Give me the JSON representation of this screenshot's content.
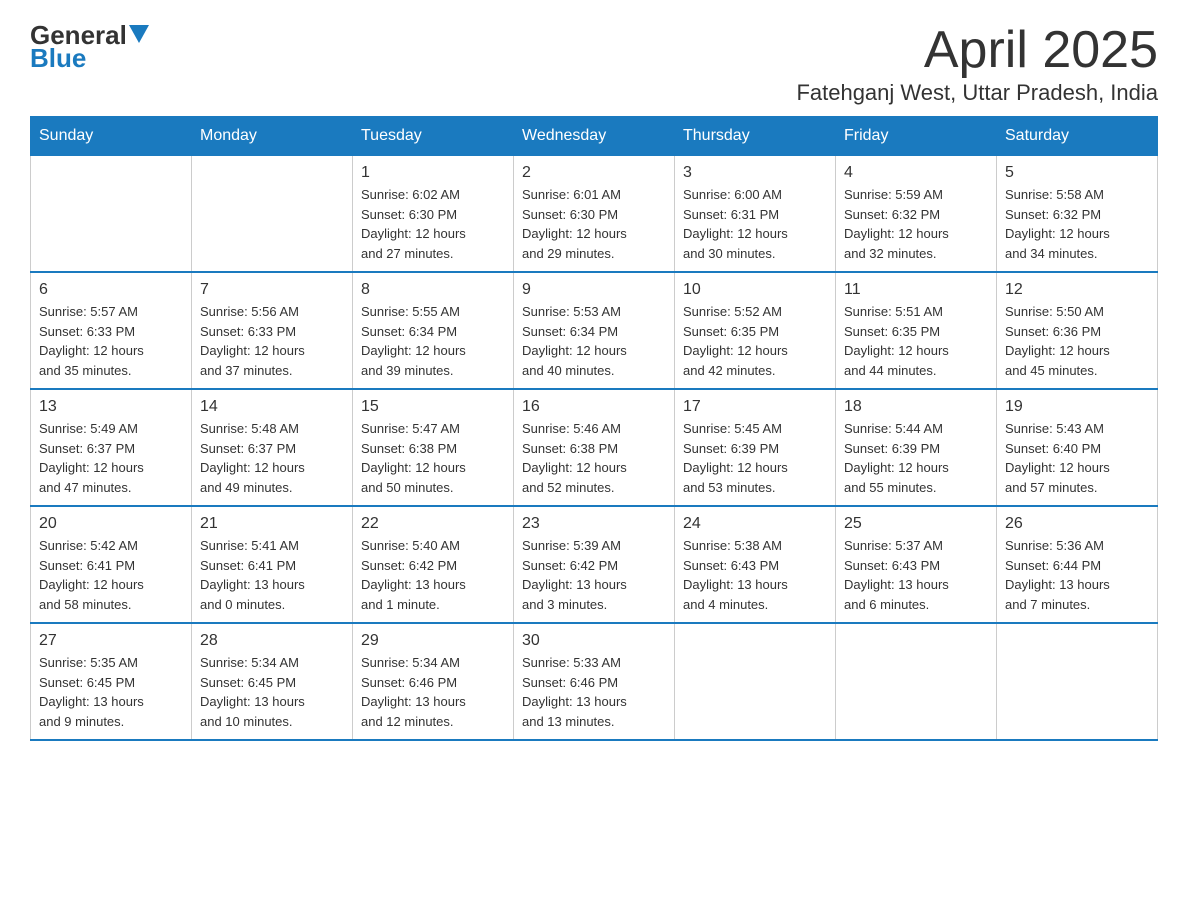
{
  "header": {
    "logo_general": "General",
    "logo_blue": "Blue",
    "month_year": "April 2025",
    "location": "Fatehganj West, Uttar Pradesh, India"
  },
  "weekdays": [
    "Sunday",
    "Monday",
    "Tuesday",
    "Wednesday",
    "Thursday",
    "Friday",
    "Saturday"
  ],
  "weeks": [
    [
      {
        "day": "",
        "info": ""
      },
      {
        "day": "",
        "info": ""
      },
      {
        "day": "1",
        "info": "Sunrise: 6:02 AM\nSunset: 6:30 PM\nDaylight: 12 hours\nand 27 minutes."
      },
      {
        "day": "2",
        "info": "Sunrise: 6:01 AM\nSunset: 6:30 PM\nDaylight: 12 hours\nand 29 minutes."
      },
      {
        "day": "3",
        "info": "Sunrise: 6:00 AM\nSunset: 6:31 PM\nDaylight: 12 hours\nand 30 minutes."
      },
      {
        "day": "4",
        "info": "Sunrise: 5:59 AM\nSunset: 6:32 PM\nDaylight: 12 hours\nand 32 minutes."
      },
      {
        "day": "5",
        "info": "Sunrise: 5:58 AM\nSunset: 6:32 PM\nDaylight: 12 hours\nand 34 minutes."
      }
    ],
    [
      {
        "day": "6",
        "info": "Sunrise: 5:57 AM\nSunset: 6:33 PM\nDaylight: 12 hours\nand 35 minutes."
      },
      {
        "day": "7",
        "info": "Sunrise: 5:56 AM\nSunset: 6:33 PM\nDaylight: 12 hours\nand 37 minutes."
      },
      {
        "day": "8",
        "info": "Sunrise: 5:55 AM\nSunset: 6:34 PM\nDaylight: 12 hours\nand 39 minutes."
      },
      {
        "day": "9",
        "info": "Sunrise: 5:53 AM\nSunset: 6:34 PM\nDaylight: 12 hours\nand 40 minutes."
      },
      {
        "day": "10",
        "info": "Sunrise: 5:52 AM\nSunset: 6:35 PM\nDaylight: 12 hours\nand 42 minutes."
      },
      {
        "day": "11",
        "info": "Sunrise: 5:51 AM\nSunset: 6:35 PM\nDaylight: 12 hours\nand 44 minutes."
      },
      {
        "day": "12",
        "info": "Sunrise: 5:50 AM\nSunset: 6:36 PM\nDaylight: 12 hours\nand 45 minutes."
      }
    ],
    [
      {
        "day": "13",
        "info": "Sunrise: 5:49 AM\nSunset: 6:37 PM\nDaylight: 12 hours\nand 47 minutes."
      },
      {
        "day": "14",
        "info": "Sunrise: 5:48 AM\nSunset: 6:37 PM\nDaylight: 12 hours\nand 49 minutes."
      },
      {
        "day": "15",
        "info": "Sunrise: 5:47 AM\nSunset: 6:38 PM\nDaylight: 12 hours\nand 50 minutes."
      },
      {
        "day": "16",
        "info": "Sunrise: 5:46 AM\nSunset: 6:38 PM\nDaylight: 12 hours\nand 52 minutes."
      },
      {
        "day": "17",
        "info": "Sunrise: 5:45 AM\nSunset: 6:39 PM\nDaylight: 12 hours\nand 53 minutes."
      },
      {
        "day": "18",
        "info": "Sunrise: 5:44 AM\nSunset: 6:39 PM\nDaylight: 12 hours\nand 55 minutes."
      },
      {
        "day": "19",
        "info": "Sunrise: 5:43 AM\nSunset: 6:40 PM\nDaylight: 12 hours\nand 57 minutes."
      }
    ],
    [
      {
        "day": "20",
        "info": "Sunrise: 5:42 AM\nSunset: 6:41 PM\nDaylight: 12 hours\nand 58 minutes."
      },
      {
        "day": "21",
        "info": "Sunrise: 5:41 AM\nSunset: 6:41 PM\nDaylight: 13 hours\nand 0 minutes."
      },
      {
        "day": "22",
        "info": "Sunrise: 5:40 AM\nSunset: 6:42 PM\nDaylight: 13 hours\nand 1 minute."
      },
      {
        "day": "23",
        "info": "Sunrise: 5:39 AM\nSunset: 6:42 PM\nDaylight: 13 hours\nand 3 minutes."
      },
      {
        "day": "24",
        "info": "Sunrise: 5:38 AM\nSunset: 6:43 PM\nDaylight: 13 hours\nand 4 minutes."
      },
      {
        "day": "25",
        "info": "Sunrise: 5:37 AM\nSunset: 6:43 PM\nDaylight: 13 hours\nand 6 minutes."
      },
      {
        "day": "26",
        "info": "Sunrise: 5:36 AM\nSunset: 6:44 PM\nDaylight: 13 hours\nand 7 minutes."
      }
    ],
    [
      {
        "day": "27",
        "info": "Sunrise: 5:35 AM\nSunset: 6:45 PM\nDaylight: 13 hours\nand 9 minutes."
      },
      {
        "day": "28",
        "info": "Sunrise: 5:34 AM\nSunset: 6:45 PM\nDaylight: 13 hours\nand 10 minutes."
      },
      {
        "day": "29",
        "info": "Sunrise: 5:34 AM\nSunset: 6:46 PM\nDaylight: 13 hours\nand 12 minutes."
      },
      {
        "day": "30",
        "info": "Sunrise: 5:33 AM\nSunset: 6:46 PM\nDaylight: 13 hours\nand 13 minutes."
      },
      {
        "day": "",
        "info": ""
      },
      {
        "day": "",
        "info": ""
      },
      {
        "day": "",
        "info": ""
      }
    ]
  ]
}
